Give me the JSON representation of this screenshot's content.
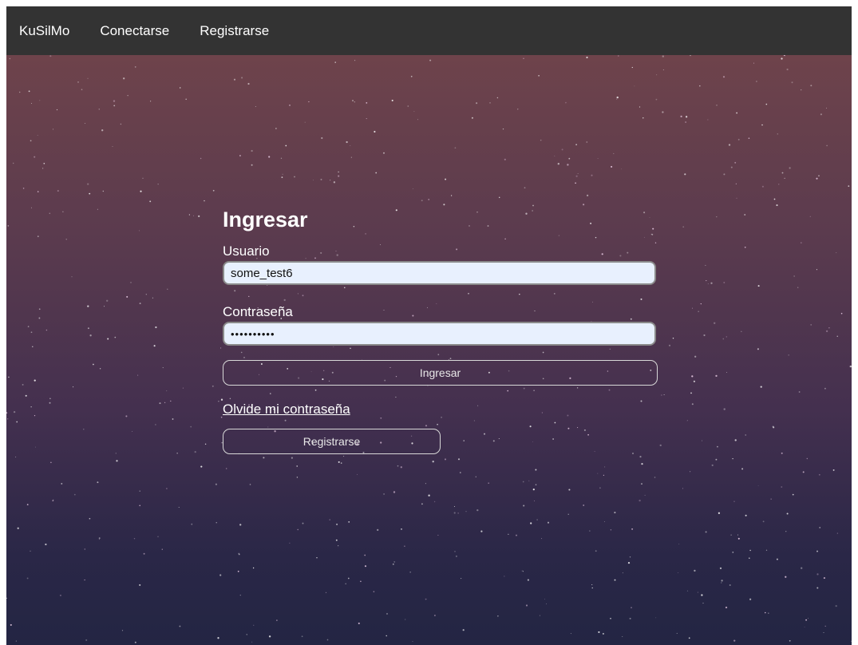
{
  "navbar": {
    "brand": "KuSilMo",
    "links": [
      "Conectarse",
      "Registrarse"
    ]
  },
  "login_form": {
    "title": "Ingresar",
    "username_label": "Usuario",
    "username_value": "some_test6",
    "password_label": "Contraseña",
    "password_value": "••••••••••",
    "submit_label": "Ingresar",
    "forgot_password_link": "Olvide mi contraseña",
    "register_label": "Registrarse"
  },
  "colors": {
    "navbar_background": "#333333",
    "gradient_top": "#6e434b",
    "gradient_bottom": "#232543",
    "input_background": "#e8f0fe"
  }
}
